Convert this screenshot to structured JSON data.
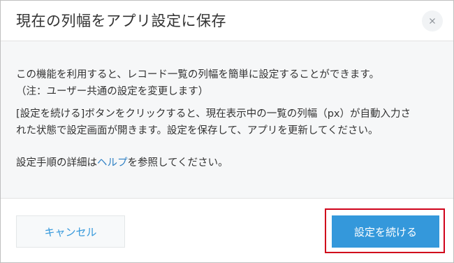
{
  "dialog": {
    "title": "現在の列幅をアプリ設定に保存",
    "close_icon": "close-icon",
    "close_glyph": "×"
  },
  "body": {
    "paragraph1": {
      "line1": "この機能を利用すると、レコード一覧の列幅を簡単に設定することができます。",
      "line2": "（注：ユーザー共通の設定を変更します）"
    },
    "paragraph2": {
      "line1": "[設定を続ける]ボタンをクリックすると、現在表示中の一覧の列幅（px）が自動入力さ",
      "line2": "れた状態で設定画面が開きます。設定を保存して、アプリを更新してください。"
    },
    "paragraph3": {
      "prefix": "設定手順の詳細は",
      "link": "ヘルプ",
      "suffix": "を参照してください。"
    }
  },
  "footer": {
    "cancel_label": "キャンセル",
    "continue_label": "設定を続ける"
  },
  "colors": {
    "accent": "#3498db",
    "link": "#2f80c4",
    "highlight": "#d0021b",
    "body_bg": "#f6f7f8"
  }
}
